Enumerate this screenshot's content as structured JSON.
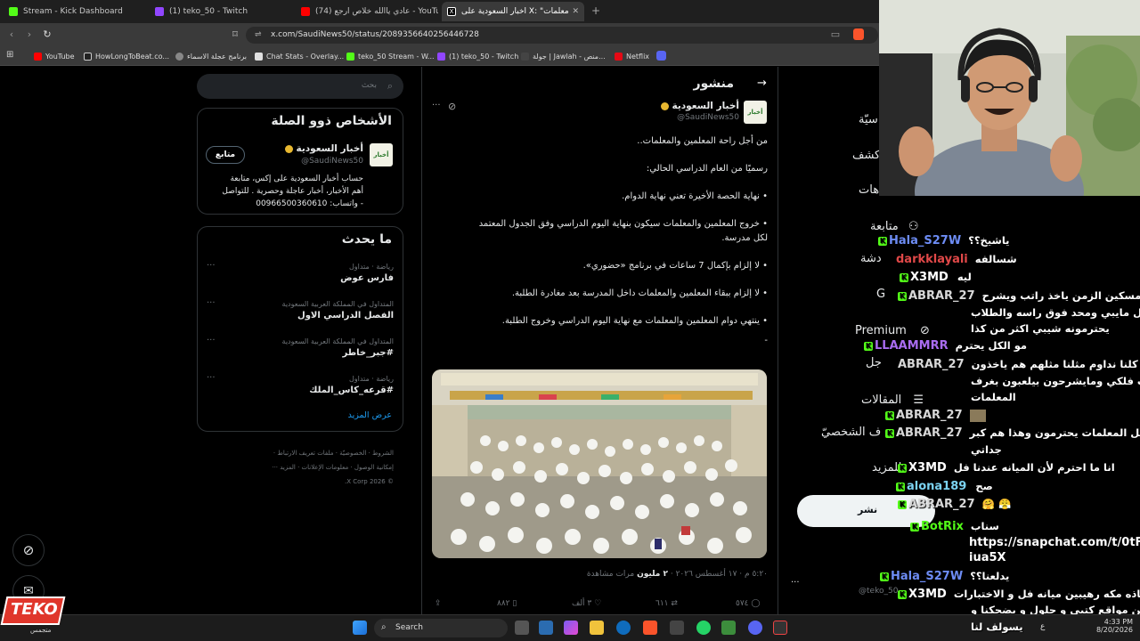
{
  "tabs": [
    {
      "label": "Stream - Kick Dashboard",
      "color": "#53fc18"
    },
    {
      "label": "(1) teko_50 - Twitch",
      "color": "#9146ff"
    },
    {
      "label": "(74) عادي ياالله خلاص ارجع - YouTube",
      "color": "#ff0000"
    },
    {
      "label": "أخبار السعودية على X: \"معلّمات...\" / X",
      "color": "#ffffff"
    }
  ],
  "address": {
    "url": "x.com/SaudiNews50/status/2089356640256446728"
  },
  "bookmarks": [
    {
      "label": "YouTube",
      "color": "#ff0000"
    },
    {
      "label": "HowLongToBeat.co...",
      "color": "#333333"
    },
    {
      "label": "برنامج عجلة الاسماء",
      "color": "#888888"
    },
    {
      "label": "Chat Stats - Overlay...",
      "color": "#e0e0e0"
    },
    {
      "label": "teko_50 Stream - W...",
      "color": "#53fc18"
    },
    {
      "label": "(1) teko_50 - Twitch",
      "color": "#9146ff"
    },
    {
      "label": "جولة | Jawlah - منص...",
      "color": "#444444"
    },
    {
      "label": "Netflix",
      "color": "#e50914"
    }
  ],
  "search": {
    "placeholder": "بحث"
  },
  "related": {
    "title": "الأشخاص ذوو الصلة",
    "name": "أخبار السعودية",
    "handle": "@SaudiNews50",
    "follow": "متابع",
    "bio_1": "حساب أخبار السعودية على إكس، متابعة",
    "bio_2": "أهم الأخبار، أخبار عاجلة وحصرية . للتواصل",
    "bio_3": "- واتساب: 00966500360610"
  },
  "trends": {
    "title": "ما يحدث",
    "items": [
      {
        "meta": "رياضة · متداول",
        "name": "فارس عوض"
      },
      {
        "meta": "المتداول في المملكة العربية السعودية",
        "name": "الفصل الدراسي الاول"
      },
      {
        "meta": "المتداول في المملكة العربية السعودية",
        "name": "#جبر_خاطر"
      },
      {
        "meta": "رياضة · متداول",
        "name": "#قرعه_كاس_الملك"
      }
    ],
    "more": "عرض المزيد"
  },
  "footer": {
    "line1": "الشروط · الخصوصيّة · ملفات تعريف الارتباط ·",
    "line2": "إمكانية الوصول · معلومات الإعلانات · المزيد ···",
    "line3": "© 2026 X Corp."
  },
  "post": {
    "header": "منشور",
    "author": "أخبار السعودية",
    "handle": "@SaudiNews50",
    "lines": [
      "من أجل راحة المعلمين والمعلمات..",
      "رسميًا من العام الدراسي الحالي:",
      "• نهاية الحصة الأخيرة تعني نهاية الدوام.",
      "• خروج المعلمين والمعلمات سيكون بنهاية اليوم الدراسي وفق الجدول المعتمد",
      "لكل مدرسة.",
      "• لا إلزام بإكمال 7 ساعات في برنامج «حضوري».",
      "• لا إلزام ببقاء المعلمين والمعلمات داخل المدرسة بعد مغادرة الطلبة.",
      "• ينتهي دوام المعلمين والمعلمات مع نهاية اليوم الدراسي وخروج الطلبة."
    ],
    "ellipsis": "-",
    "timestamp": "٥:٢٠ م · ١٧ أغسطس ٢٠٢٦ ·",
    "views": "٢ مليون",
    "views_label": "مرات مشاهدة",
    "actions": {
      "replies": "٥٧٤",
      "reposts": "٦١١",
      "likes": "٣ ألف",
      "bookmarks": "٨٨٢"
    }
  },
  "nav": {
    "items": [
      "متابعة",
      "Premium",
      "المقالات",
      "ف الشخصيّ",
      "للمزيد"
    ],
    "partials": [
      "سيّة",
      "كشف",
      "هات",
      "دشة",
      "G",
      "جل"
    ],
    "post_btn": "نشر",
    "user_handle": "@teko_50",
    "more_dots": "···"
  },
  "chat": [
    {
      "user": "Hala_S27W",
      "color": "#6d8cf4",
      "msg": "ياشيخ؟؟"
    },
    {
      "user": "darkklayali",
      "color": "#e04848",
      "msg": "شسالفه"
    },
    {
      "user": "X3MD",
      "color": "#ffffff",
      "msg": "ليه"
    },
    {
      "user": "ABRAR_27",
      "color": "#d8d8d8",
      "msg": "بيوي مسكين الزمن ياخذ راتب ويشرح"
    },
    {
      "user": "",
      "color": "#ffffff",
      "msg": "مثل مايبي ومحد فوق راسه والطلاب"
    },
    {
      "user": "",
      "color": "#ffffff",
      "msg": "يحترمونه شيبي اكثر من كذا"
    },
    {
      "user": "LLAAMMRR",
      "color": "#a96cf0",
      "msg": "مو الكل يحترم"
    },
    {
      "user": "ABRAR_27",
      "color": "#d8d8d8",
      "msg": "بيوي كلنا نداوم مثلنا مثلهم هم ياخذون"
    },
    {
      "user": "",
      "color": "#ffffff",
      "msg": "راتب فلكي ومايشرحون بيلعبون بغرف"
    },
    {
      "user": "",
      "color": "#ffffff",
      "msg": "المعلمات"
    },
    {
      "user": "ABRAR_27",
      "color": "#d8d8d8",
      "msg": ""
    },
    {
      "user": "ABRAR_27",
      "color": "#d8d8d8",
      "msg": "ومو كل المعلمات يحترمون وهذا هم كبر"
    },
    {
      "user": "",
      "color": "#ffffff",
      "msg": "جداتي"
    },
    {
      "user": "X3MD",
      "color": "#ffffff",
      "msg": "انا ما احترم لأن الميانه عندنا فل"
    },
    {
      "user": "alona189",
      "color": "#7bd3f2",
      "msg": "صح"
    },
    {
      "user": "ABRAR_27",
      "color": "#d8d8d8",
      "msg": "🤗 😤"
    },
    {
      "user": "BotRix",
      "color": "#53fc18",
      "msg": "سناب"
    },
    {
      "user": "",
      "color": "#ffffff",
      "msg": "https://snapchat.com/t/0tF"
    },
    {
      "user": "",
      "color": "#ffffff",
      "msg": "iua5X"
    },
    {
      "user": "Hala_S27W",
      "color": "#6d8cf4",
      "msg": "يدلعنا؟؟"
    },
    {
      "user": "X3MD",
      "color": "#ffffff",
      "msg": "استاذه مكه رهيبين ميانه فل و الاختبارات"
    },
    {
      "user": "",
      "color": "#ffffff",
      "msg": "من مواقع كتبي و حلول و يضحكنا و"
    },
    {
      "user": "",
      "color": "#ffffff",
      "msg": "يسولف لنا"
    }
  ],
  "taskbar": {
    "search": "Search",
    "time": "4:33 PM",
    "date": "8/20/2026",
    "lang": "ع"
  },
  "logo": {
    "text": "TEKO",
    "sub": "متجمس"
  }
}
